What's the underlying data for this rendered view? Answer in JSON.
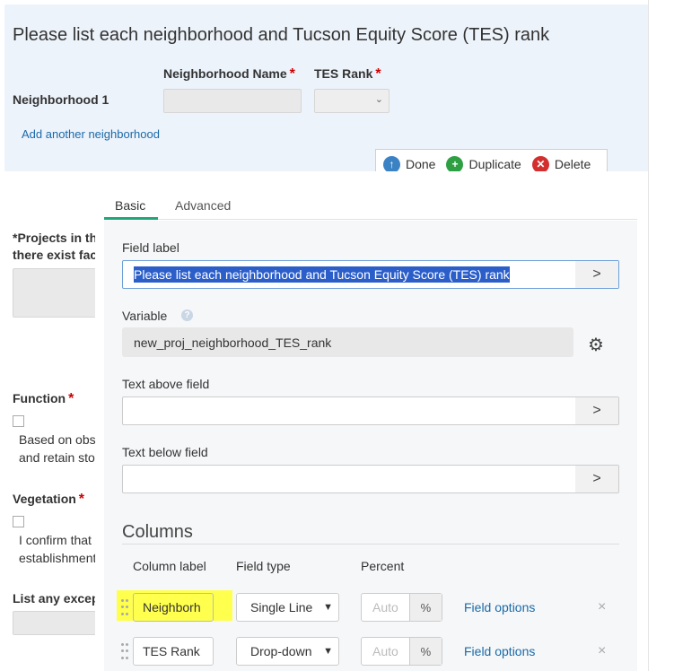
{
  "form": {
    "title": "Please list each neighborhood and Tucson Equity Score (TES) rank",
    "col_neighborhood": "Neighborhood Name",
    "col_tes": "TES Rank",
    "required_mark": "*",
    "row1_label": "Neighborhood 1",
    "add_link": "Add another neighborhood",
    "projects_line1": "*Projects in th",
    "projects_line2": "there exist fac",
    "function_label": "Function",
    "function_text1": "Based on obs",
    "function_text2": "and retain sto",
    "vegetation_label": "Vegetation",
    "vegetation_text1": "I confirm that",
    "vegetation_text2": "establishment",
    "exceptions_label": "List any excep"
  },
  "toolbar": {
    "done": "Done",
    "duplicate": "Duplicate",
    "delete": "Delete",
    "colors": {
      "done": "#3b82c4",
      "duplicate": "#2ea043",
      "delete": "#d32f2f"
    }
  },
  "tabs": [
    {
      "label": "Basic",
      "active": true
    },
    {
      "label": "Advanced",
      "active": false
    }
  ],
  "editor": {
    "field_label_label": "Field label",
    "field_label_value": "Please list each neighborhood and Tucson Equity Score (TES) rank",
    "variable_label": "Variable",
    "variable_value": "new_proj_neighborhood_TES_rank",
    "text_above_label": "Text above field",
    "text_below_label": "Text below field",
    "arrow": ">",
    "help": "?",
    "gear": "⚙"
  },
  "columns": {
    "title": "Columns",
    "headers": {
      "label": "Column label",
      "type": "Field type",
      "percent": "Percent"
    },
    "rows": [
      {
        "label": "Neighborh",
        "type": "Single Line",
        "percent_placeholder": "Auto",
        "unit": "%",
        "options": "Field options",
        "remove": "×"
      },
      {
        "label": "TES Rank",
        "type": "Drop-down",
        "percent_placeholder": "Auto",
        "unit": "%",
        "options": "Field options",
        "remove": "×"
      }
    ]
  }
}
